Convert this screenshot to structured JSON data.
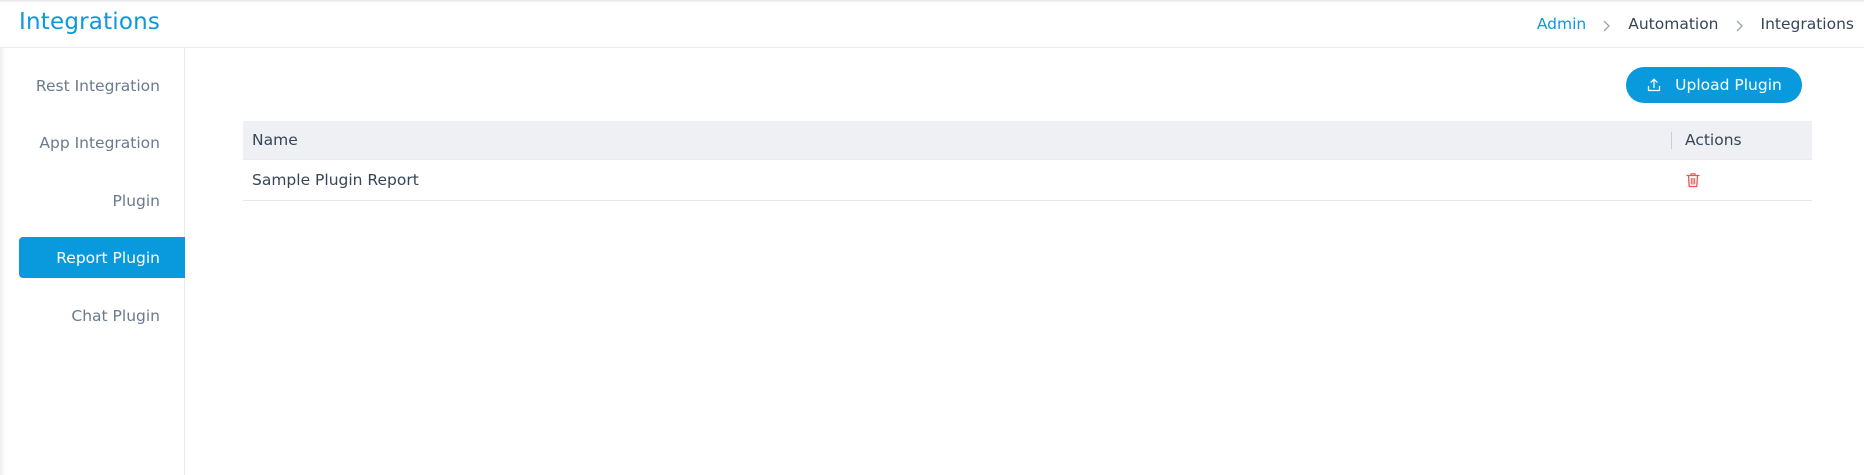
{
  "header": {
    "title": "Integrations",
    "breadcrumb": [
      "Admin",
      "Automation",
      "Integrations"
    ]
  },
  "sidebar": {
    "items": [
      {
        "label": "Rest Integration",
        "active": false
      },
      {
        "label": "App Integration",
        "active": false
      },
      {
        "label": "Plugin",
        "active": false
      },
      {
        "label": "Report Plugin",
        "active": true
      },
      {
        "label": "Chat Plugin",
        "active": false
      }
    ]
  },
  "toolbar": {
    "upload_label": "Upload Plugin",
    "upload_icon": "upload-icon"
  },
  "table": {
    "columns": [
      "Name",
      "Actions"
    ],
    "rows": [
      {
        "name": "Sample Plugin Report",
        "action_icon": "trash-icon"
      }
    ]
  },
  "colors": {
    "accent": "#099add",
    "delete": "#e05a4f",
    "text": "#364658",
    "muted": "#6b7a8c",
    "table_header_bg": "#eef0f4"
  }
}
